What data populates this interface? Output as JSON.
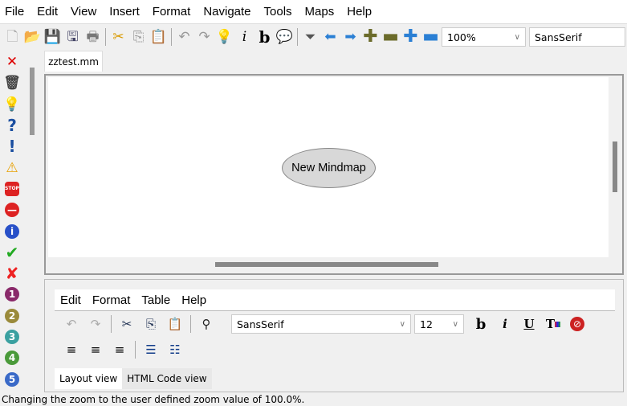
{
  "menubar": [
    "File",
    "Edit",
    "View",
    "Insert",
    "Format",
    "Navigate",
    "Tools",
    "Maps",
    "Help"
  ],
  "toolbar": {
    "zoom": "100%",
    "font": "SansSerif"
  },
  "tab": "zztest.mm",
  "node": "New Mindmap",
  "editor": {
    "menu": [
      "Edit",
      "Format",
      "Table",
      "Help"
    ],
    "font": "SansSerif",
    "size": "12",
    "tabs": [
      "Layout view",
      "HTML Code view"
    ]
  },
  "status": "Changing the zoom to the user defined zoom value of 100.0%."
}
